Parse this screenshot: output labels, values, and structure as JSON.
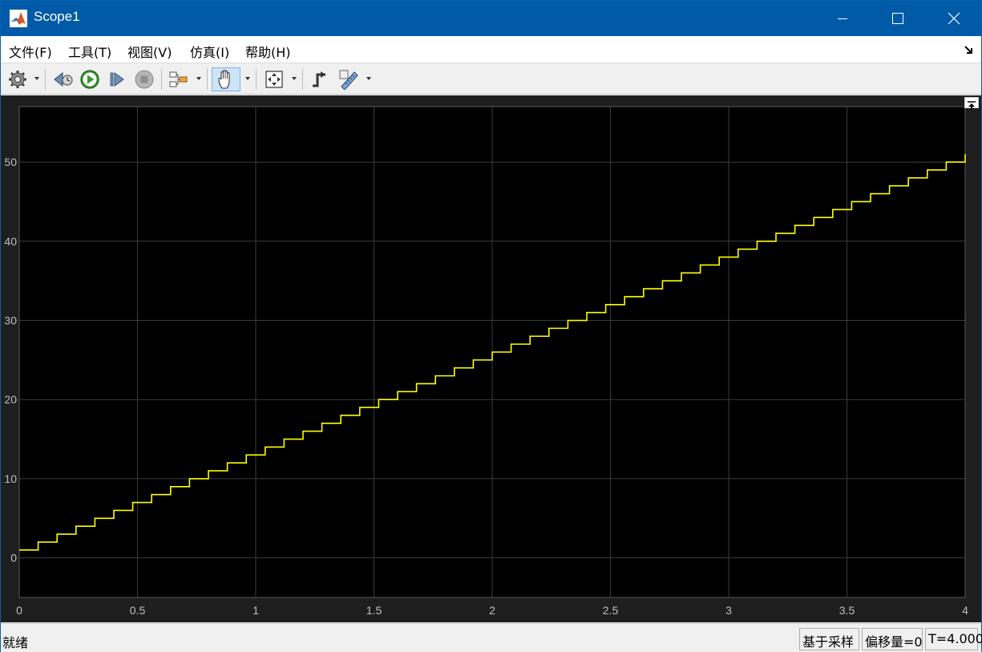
{
  "window": {
    "title": "Scope1",
    "controls": {
      "minimize": "minimize-icon",
      "maximize": "maximize-icon",
      "close": "close-icon"
    }
  },
  "menu": {
    "items": [
      "文件(F)",
      "工具(T)",
      "视图(V)",
      "仿真(I)",
      "帮助(H)"
    ]
  },
  "toolbar": {
    "items": [
      "gear-icon",
      "step-back-icon",
      "run-icon",
      "step-forward-icon",
      "stop-icon",
      "signal-selector-icon",
      "pan-icon",
      "zoom-fit-icon",
      "triggers-icon",
      "measurements-icon"
    ]
  },
  "colors": {
    "titlebar": "#005aa8",
    "plot_background": "#000000",
    "panel_background": "#1e1e1e",
    "trace": "#ffff00",
    "grid": "#3c3c3c",
    "tick_text": "#bfbfbf"
  },
  "chart_data": {
    "type": "line",
    "step": true,
    "x_tick_labels": [
      "0",
      "0.5",
      "1",
      "1.5",
      "2",
      "2.5",
      "3",
      "3.5",
      "4"
    ],
    "y_tick_labels": [
      "0",
      "10",
      "20",
      "30",
      "40",
      "50"
    ],
    "xlim": [
      0,
      4
    ],
    "ylim": [
      -5,
      57
    ],
    "grid": true,
    "series": [
      {
        "sample_time": 0.08,
        "start_value": 1,
        "increment": 1,
        "x_end": 4,
        "y_end": 51
      }
    ]
  },
  "status": {
    "text": "就绪",
    "mode": "基于采样",
    "offset": "偏移量=0",
    "time": "T=4.000"
  }
}
